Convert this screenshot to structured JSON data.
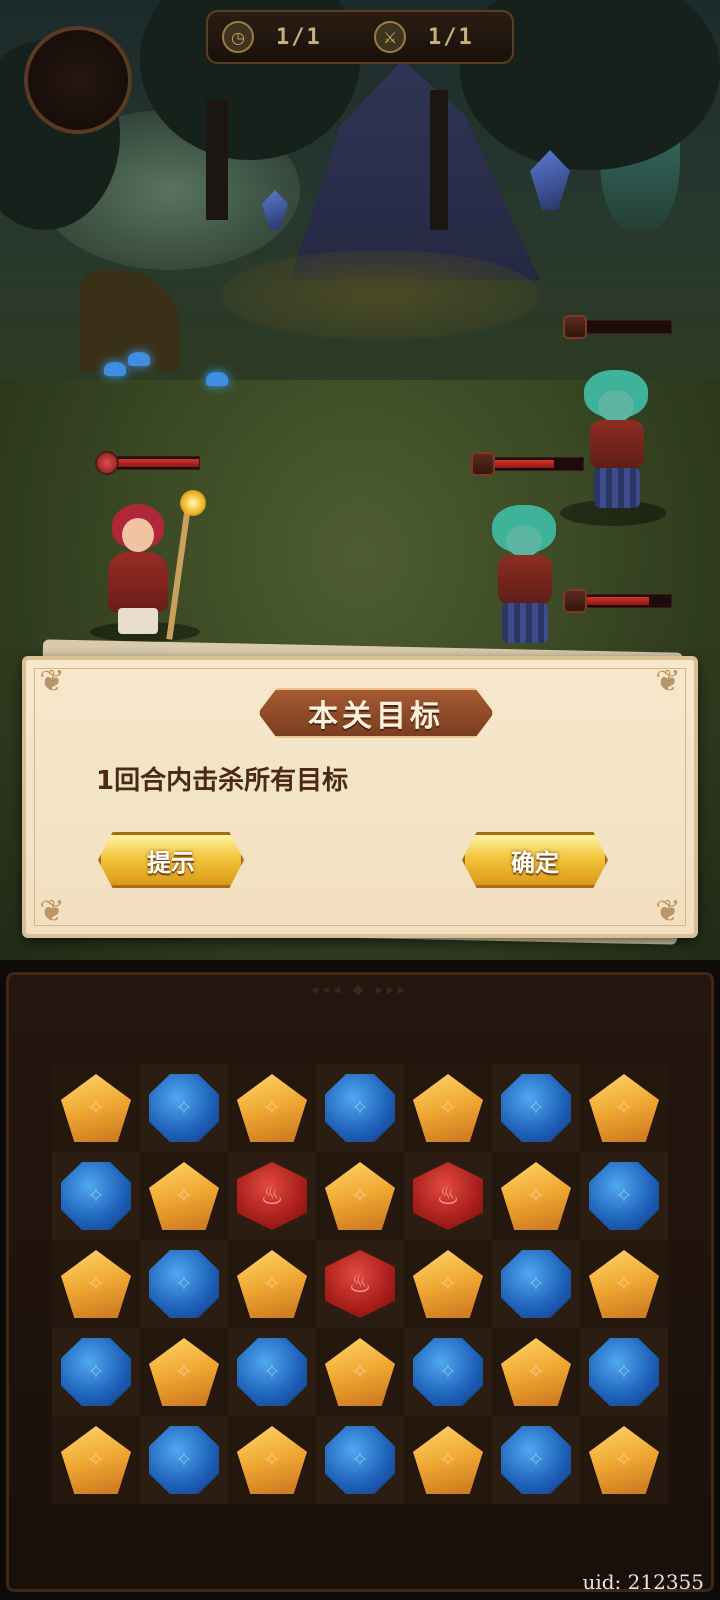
{
  "hud": {
    "turns_icon": "clock-icon",
    "turns_value": "1/1",
    "kills_icon": "sword-icon",
    "kills_value": "1/1"
  },
  "scene": {
    "enemies": [
      {
        "name": "zombie",
        "hp_fraction": 0.0
      },
      {
        "name": "zombie",
        "hp_fraction": 0.72
      },
      {
        "name": "zombie",
        "hp_fraction": 0.78
      }
    ],
    "hero": {
      "hp_fraction": 1.0
    }
  },
  "dialog": {
    "title": "本关目标",
    "objective": "1回合内击杀所有目标",
    "hint_button": "提示",
    "confirm_button": "确定"
  },
  "board": {
    "rows": [
      [
        "gold",
        "blue",
        "gold",
        "blue",
        "gold",
        "blue",
        "gold"
      ],
      [
        "blue",
        "gold",
        "red",
        "gold",
        "red",
        "gold",
        "blue"
      ],
      [
        "gold",
        "blue",
        "gold",
        "red",
        "gold",
        "blue",
        "gold"
      ],
      [
        "blue",
        "gold",
        "blue",
        "gold",
        "blue",
        "gold",
        "blue"
      ],
      [
        "gold",
        "blue",
        "gold",
        "blue",
        "gold",
        "blue",
        "gold"
      ]
    ],
    "gem_icons": {
      "gold": "crack-icon",
      "blue": "crack-icon",
      "red": "flame-icon"
    }
  },
  "uid": "uid: 212355",
  "colors": {
    "dialog_bg": "#f7e8cc",
    "title_banner": "#a55a33",
    "button_gold": "#f2c53c",
    "hp_red": "#d8322b"
  }
}
